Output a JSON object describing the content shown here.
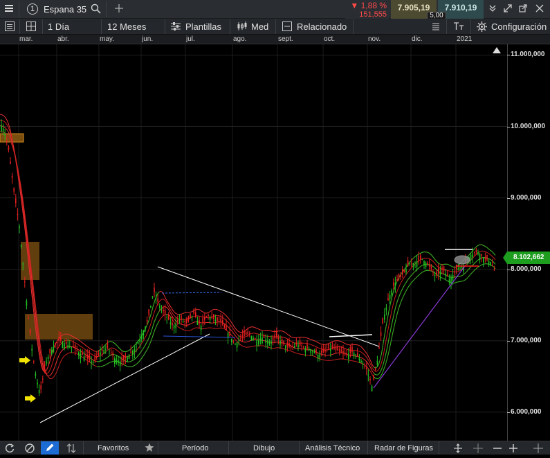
{
  "title_bar": {
    "menu_icon": "hamburger-icon",
    "instrument_number": "1",
    "instrument_name": "Espana 35",
    "search_icon": "search-icon",
    "add_icon": "plus-icon",
    "change_percent": "▼ 1,88 %",
    "change_points": "151,555",
    "sell_price": "7.905,19",
    "buy_price": "7.910,19",
    "spread": "5,00",
    "window_icons": [
      "collapse-icon",
      "expand-icon",
      "popout-icon",
      "close-icon"
    ]
  },
  "toolbar": {
    "interval": "1 Día",
    "period": "12 Meses",
    "templates": "Plantillas",
    "chart_style": "Med",
    "related": "Relacionado",
    "settings": "Configuración"
  },
  "bottom_bar": {
    "favorites": "Favoritos",
    "period": "Período",
    "drawing": "Dibujo",
    "technical_analysis": "Análisis Técnico",
    "pattern_radar": "Radar de Figuras"
  },
  "colors": {
    "up": "#22c322",
    "down": "#e82020",
    "ribbon_red": "#e02a2a",
    "ribbon_green": "#22b822",
    "current_price_bg": "#1e9e1e",
    "box_fill": "#8a5a10"
  },
  "chart_data": {
    "type": "candlestick",
    "instrument": "Espana 35",
    "x_labels": [
      "mar.",
      "abr.",
      "may.",
      "jun.",
      "jul.",
      "ago.",
      "sept.",
      "oct.",
      "nov.",
      "dic.",
      "2021"
    ],
    "y_ticks": [
      6000,
      7000,
      8000,
      9000,
      10000,
      11000
    ],
    "y_tick_labels": [
      "6.000,000",
      "7.000,000",
      "8.000,000",
      "9.000,000",
      "10.000,000",
      "11.000,000"
    ],
    "ylim": [
      5600,
      11150
    ],
    "current_price": 8102.662,
    "current_price_label": "8.102,662",
    "grid": true,
    "close_path": [
      [
        0,
        10050
      ],
      [
        6,
        9950
      ],
      [
        12,
        9700
      ],
      [
        20,
        9100
      ],
      [
        28,
        8600
      ],
      [
        34,
        8000
      ],
      [
        40,
        7400
      ],
      [
        46,
        6900
      ],
      [
        52,
        6500
      ],
      [
        58,
        6250
      ],
      [
        66,
        6700
      ],
      [
        76,
        6900
      ],
      [
        86,
        7000
      ],
      [
        96,
        6950
      ],
      [
        106,
        6900
      ],
      [
        116,
        6820
      ],
      [
        126,
        6750
      ],
      [
        136,
        6700
      ],
      [
        146,
        6850
      ],
      [
        156,
        6900
      ],
      [
        166,
        6750
      ],
      [
        176,
        6700
      ],
      [
        186,
        6800
      ],
      [
        196,
        6900
      ],
      [
        206,
        7100
      ],
      [
        214,
        7300
      ],
      [
        222,
        7700
      ],
      [
        230,
        7500
      ],
      [
        240,
        7350
      ],
      [
        250,
        7200
      ],
      [
        260,
        7300
      ],
      [
        270,
        7250
      ],
      [
        280,
        7380
      ],
      [
        290,
        7200
      ],
      [
        300,
        7350
      ],
      [
        310,
        7300
      ],
      [
        320,
        7250
      ],
      [
        330,
        7100
      ],
      [
        340,
        6950
      ],
      [
        350,
        7050
      ],
      [
        360,
        7100
      ],
      [
        370,
        7000
      ],
      [
        380,
        7050
      ],
      [
        390,
        6980
      ],
      [
        400,
        7050
      ],
      [
        410,
        6950
      ],
      [
        420,
        6900
      ],
      [
        430,
        6950
      ],
      [
        440,
        6900
      ],
      [
        450,
        6880
      ],
      [
        460,
        6800
      ],
      [
        470,
        6850
      ],
      [
        480,
        6900
      ],
      [
        490,
        6850
      ],
      [
        500,
        6800
      ],
      [
        510,
        6850
      ],
      [
        520,
        6750
      ],
      [
        530,
        6600
      ],
      [
        538,
        6350
      ],
      [
        546,
        6750
      ],
      [
        554,
        7300
      ],
      [
        562,
        7600
      ],
      [
        570,
        7800
      ],
      [
        580,
        7900
      ],
      [
        590,
        8050
      ],
      [
        600,
        8100
      ],
      [
        610,
        8150
      ],
      [
        620,
        8050
      ],
      [
        630,
        7900
      ],
      [
        640,
        8000
      ],
      [
        650,
        7850
      ],
      [
        660,
        8000
      ],
      [
        670,
        8050
      ],
      [
        680,
        8200
      ],
      [
        690,
        8250
      ],
      [
        700,
        8150
      ],
      [
        710,
        8100
      ],
      [
        716,
        7950
      ]
    ]
  }
}
